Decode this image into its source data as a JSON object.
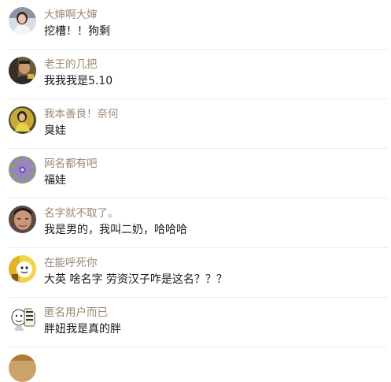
{
  "comments": [
    {
      "username": "大婶啊大婶",
      "text": "挖槽！！狗剩",
      "avatar": "woman-white-top-avatar"
    },
    {
      "username": "老王的几把",
      "text": "我我我是5.10",
      "avatar": "man-portrait-avatar"
    },
    {
      "username": "我本善良！奈何",
      "text": "臭娃",
      "avatar": "yellow-figure-avatar"
    },
    {
      "username": "网名都有吧",
      "text": "福娃",
      "avatar": "purple-flower-avatar"
    },
    {
      "username": "名字就不取了。",
      "text": "我是男的，我叫二奶，哈哈哈",
      "avatar": "man-face-avatar"
    },
    {
      "username": "在能呼死你",
      "text": "大英 啥名字 劳资汉子咋是这名？？？",
      "avatar": "cartoon-yellow-avatar"
    },
    {
      "username": "匿名用户而已",
      "text": "胖妞我是真的胖",
      "avatar": "sticker-face-avatar"
    }
  ],
  "partial_next_avatar": "partial-avatar"
}
